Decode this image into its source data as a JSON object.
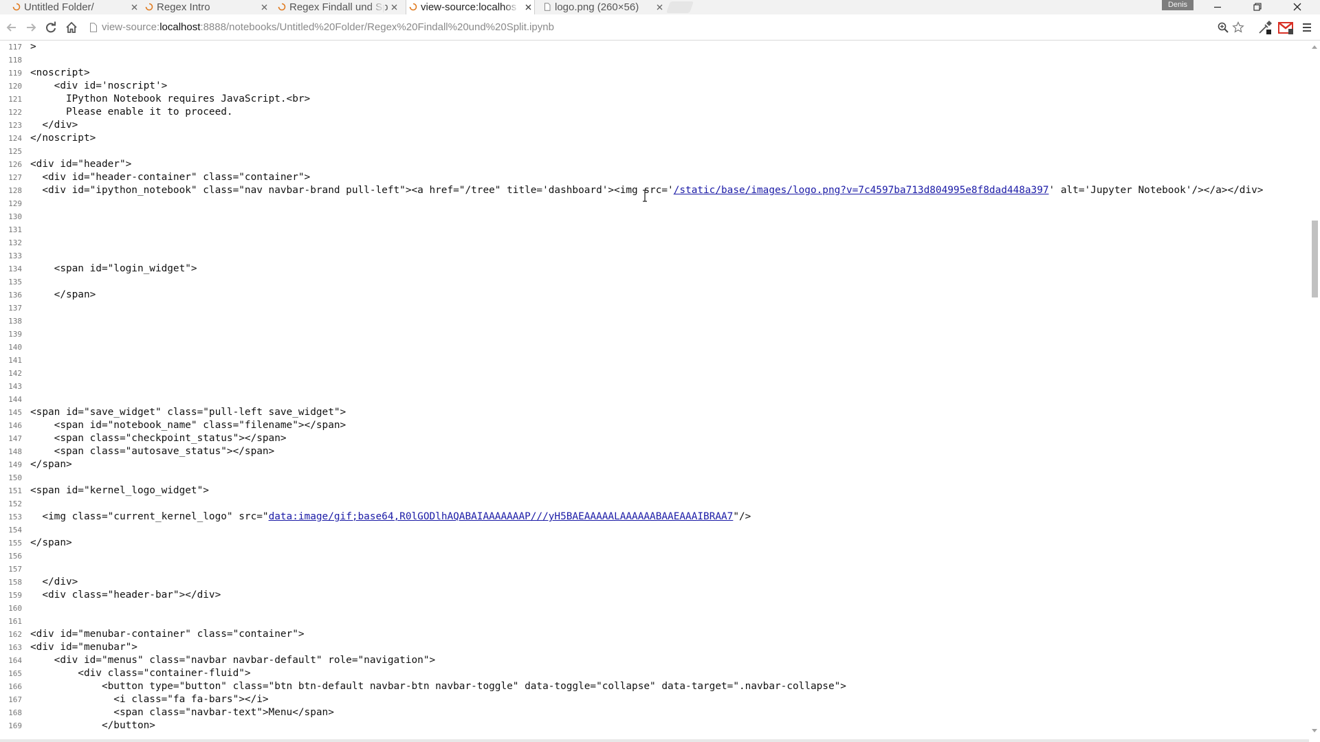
{
  "browser": {
    "tabs": [
      {
        "title": "Untitled Folder/",
        "active": false,
        "icon": "loading-spinner-icon"
      },
      {
        "title": "Regex Intro",
        "active": false,
        "icon": "loading-spinner-icon"
      },
      {
        "title": "Regex Findall und Sp",
        "active": false,
        "icon": "loading-spinner-icon"
      },
      {
        "title": "view-source:localhos",
        "active": true,
        "icon": "loading-spinner-icon"
      },
      {
        "title": "logo.png (260×56)",
        "active": false,
        "icon": "page-icon"
      }
    ],
    "profile_name": "Denis",
    "address": {
      "scheme": "view-source:",
      "host": "localhost",
      "rest": ":8888/notebooks/Untitled%20Folder/Regex%20Findall%20und%20Split.ipynb"
    },
    "colors": {
      "link": "#1a1aa6",
      "tab_strip": "#f2f2f2",
      "line_number": "#777777",
      "gmail_red": "#d93025"
    }
  },
  "source": {
    "lines": [
      {
        "n": "117",
        "text": ">"
      },
      {
        "n": "118",
        "text": ""
      },
      {
        "n": "119",
        "text": "<noscript>"
      },
      {
        "n": "120",
        "text": "    <div id='noscript'>"
      },
      {
        "n": "121",
        "text": "      IPython Notebook requires JavaScript.<br>"
      },
      {
        "n": "122",
        "text": "      Please enable it to proceed."
      },
      {
        "n": "123",
        "text": "  </div>"
      },
      {
        "n": "124",
        "text": "</noscript>"
      },
      {
        "n": "125",
        "text": ""
      },
      {
        "n": "126",
        "text": "<div id=\"header\">"
      },
      {
        "n": "127",
        "text": "  <div id=\"header-container\" class=\"container\">"
      },
      {
        "n": "128",
        "pre": "  <div id=\"ipython_notebook\" class=\"nav navbar-brand pull-left\"><a href=\"/tree\" title='dashboard'><img src='",
        "link": "/static/base/images/logo.png?v=7c4597ba713d804995e8f8dad448a397",
        "post": "' alt='Jupyter Notebook'/></a></div>"
      },
      {
        "n": "129",
        "text": ""
      },
      {
        "n": "130",
        "text": ""
      },
      {
        "n": "131",
        "text": ""
      },
      {
        "n": "132",
        "text": ""
      },
      {
        "n": "133",
        "text": ""
      },
      {
        "n": "134",
        "text": "    <span id=\"login_widget\">"
      },
      {
        "n": "135",
        "text": ""
      },
      {
        "n": "136",
        "text": "    </span>"
      },
      {
        "n": "137",
        "text": ""
      },
      {
        "n": "138",
        "text": ""
      },
      {
        "n": "139",
        "text": ""
      },
      {
        "n": "140",
        "text": ""
      },
      {
        "n": "141",
        "text": ""
      },
      {
        "n": "142",
        "text": ""
      },
      {
        "n": "143",
        "text": ""
      },
      {
        "n": "144",
        "text": ""
      },
      {
        "n": "145",
        "text": "<span id=\"save_widget\" class=\"pull-left save_widget\">"
      },
      {
        "n": "146",
        "text": "    <span id=\"notebook_name\" class=\"filename\"></span>"
      },
      {
        "n": "147",
        "text": "    <span class=\"checkpoint_status\"></span>"
      },
      {
        "n": "148",
        "text": "    <span class=\"autosave_status\"></span>"
      },
      {
        "n": "149",
        "text": "</span>"
      },
      {
        "n": "150",
        "text": ""
      },
      {
        "n": "151",
        "text": "<span id=\"kernel_logo_widget\">"
      },
      {
        "n": "152",
        "text": ""
      },
      {
        "n": "153",
        "pre": "  <img class=\"current_kernel_logo\" src=\"",
        "link": "data:image/gif;base64,R0lGODlhAQABAIAAAAAAAP///yH5BAEAAAAALAAAAAABAAEAAAIBRAA7",
        "post": "\"/>"
      },
      {
        "n": "154",
        "text": ""
      },
      {
        "n": "155",
        "text": "</span>"
      },
      {
        "n": "156",
        "text": ""
      },
      {
        "n": "157",
        "text": ""
      },
      {
        "n": "158",
        "text": "  </div>"
      },
      {
        "n": "159",
        "text": "  <div class=\"header-bar\"></div>"
      },
      {
        "n": "160",
        "text": ""
      },
      {
        "n": "161",
        "text": ""
      },
      {
        "n": "162",
        "text": "<div id=\"menubar-container\" class=\"container\">"
      },
      {
        "n": "163",
        "text": "<div id=\"menubar\">"
      },
      {
        "n": "164",
        "text": "    <div id=\"menus\" class=\"navbar navbar-default\" role=\"navigation\">"
      },
      {
        "n": "165",
        "text": "        <div class=\"container-fluid\">"
      },
      {
        "n": "166",
        "text": "            <button type=\"button\" class=\"btn btn-default navbar-btn navbar-toggle\" data-toggle=\"collapse\" data-target=\".navbar-collapse\">"
      },
      {
        "n": "167",
        "text": "              <i class=\"fa fa-bars\"></i>"
      },
      {
        "n": "168",
        "text": "              <span class=\"navbar-text\">Menu</span>"
      },
      {
        "n": "169",
        "text": "            </button>"
      }
    ]
  }
}
